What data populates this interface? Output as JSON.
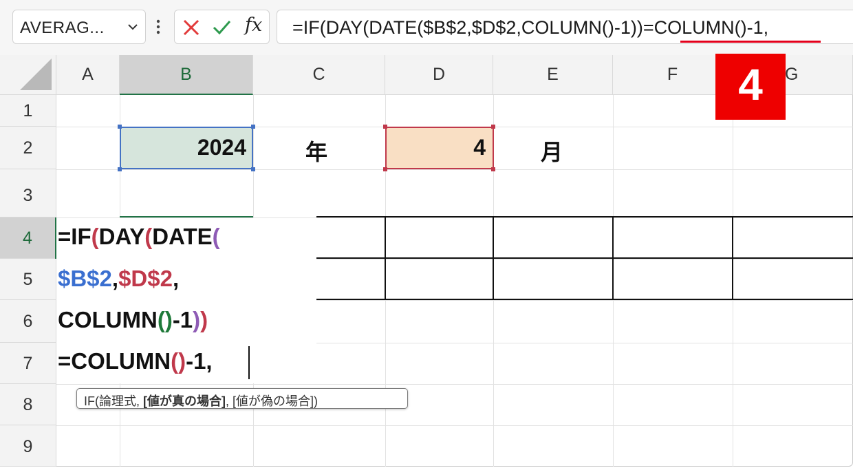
{
  "formula_bar": {
    "name_box": "AVERAG...",
    "fx_label": "fx",
    "formula": "=IF(DAY(DATE($B$2,$D$2,COLUMN()-1))=COLUMN()-1,"
  },
  "columns": [
    "A",
    "B",
    "C",
    "D",
    "E",
    "F",
    "G"
  ],
  "rows": [
    "1",
    "2",
    "3",
    "4",
    "5",
    "6",
    "7",
    "8",
    "9"
  ],
  "cells": {
    "B2": "2024",
    "C2": "年",
    "D2": "4",
    "E2": "月"
  },
  "edit_lines": {
    "l1_a": "=IF",
    "l1_b": "(",
    "l1_c": "DAY",
    "l1_d": "(",
    "l1_e": "DATE",
    "l1_f": "(",
    "l2_a": "$B$2",
    "l2_b": ",",
    "l2_c": "$D$2",
    "l2_d": ",",
    "l3_a": "COLUMN",
    "l3_b": "(",
    "l3_c": ")",
    "l3_d": "-1",
    "l3_e": ")",
    "l3_f": ")",
    "l4_a": "=COLUMN",
    "l4_b": "(",
    "l4_c": ")",
    "l4_d": "-1,"
  },
  "tooltip": {
    "prefix": "IF(論理式, ",
    "bold": "[値が真の場合]",
    "suffix": ", [値が偽の場合])"
  },
  "badge": "4",
  "colors": {
    "badge": "#ee0000",
    "underline": "#e3001b",
    "selection_green": "#217346",
    "ref_blue": "#3a6fd0",
    "ref_red": "#c0394b",
    "paren_purple": "#8e5bb5"
  }
}
